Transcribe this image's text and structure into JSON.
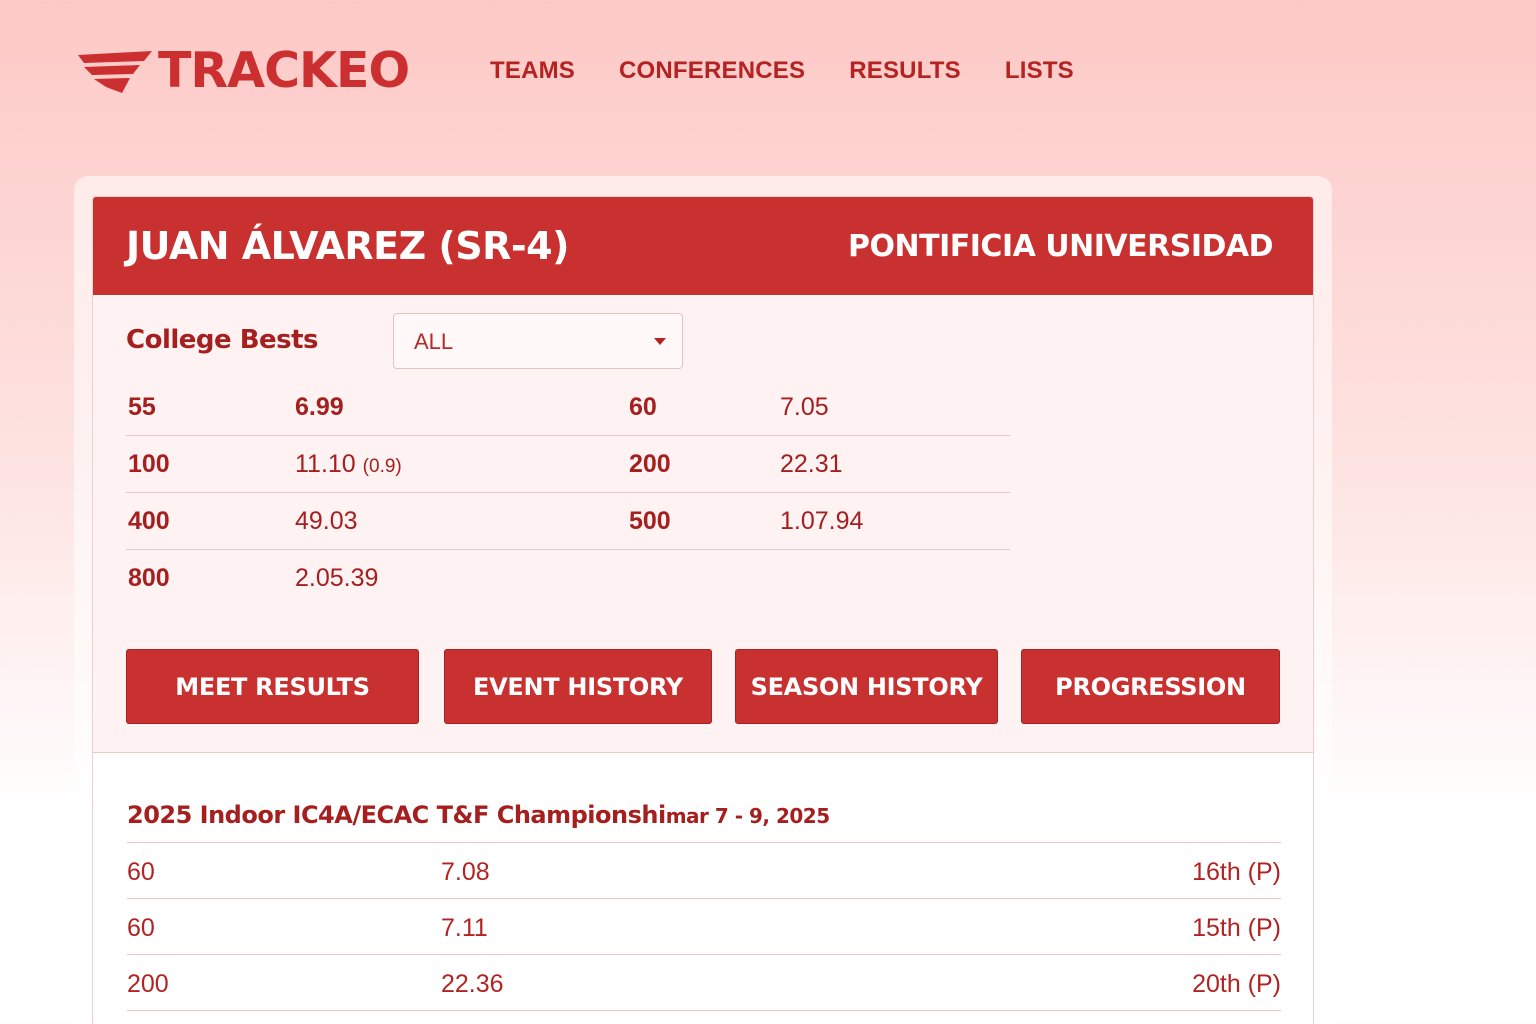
{
  "brand": {
    "name": "TRACKEO"
  },
  "nav": [
    "TEAMS",
    "CONFERENCES",
    "RESULTS",
    "LISTS"
  ],
  "athlete": {
    "name": "JUAN ÁLVAREZ (SR-4)",
    "school": "PONTIFICIA UNIVERSIDAD"
  },
  "bests": {
    "title": "College Bests",
    "filter": {
      "selected": "ALL"
    },
    "rows": [
      [
        {
          "event": "55",
          "mark": "6.99",
          "wind": ""
        },
        {
          "event": "60",
          "mark": "7.05",
          "wind": ""
        }
      ],
      [
        {
          "event": "100",
          "mark": "11.10",
          "wind": "(0.9)"
        },
        {
          "event": "200",
          "mark": "22.31",
          "wind": ""
        }
      ],
      [
        {
          "event": "400",
          "mark": "49.03",
          "wind": ""
        },
        {
          "event": "500",
          "mark": "1.07.94",
          "wind": ""
        }
      ],
      [
        {
          "event": "800",
          "mark": "2.05.39",
          "wind": ""
        }
      ]
    ]
  },
  "tabs": [
    "MEET RESULTS",
    "EVENT HISTORY",
    "SEASON HISTORY",
    "PROGRESSION"
  ],
  "meet": {
    "title": "2025 Indoor IC4A/ECAC T&F Championshi",
    "date": "mar 7 - 9, 2025",
    "results": [
      {
        "event": "60",
        "mark": "7.08",
        "place": "16th (P)"
      },
      {
        "event": "60",
        "mark": "7.11",
        "place": "15th (P)"
      },
      {
        "event": "200",
        "mark": "22.36",
        "place": "20th (P)"
      }
    ]
  },
  "colors": {
    "accent": "#c93030",
    "text": "#a51f1f",
    "page_top": "#fdc9c6"
  }
}
